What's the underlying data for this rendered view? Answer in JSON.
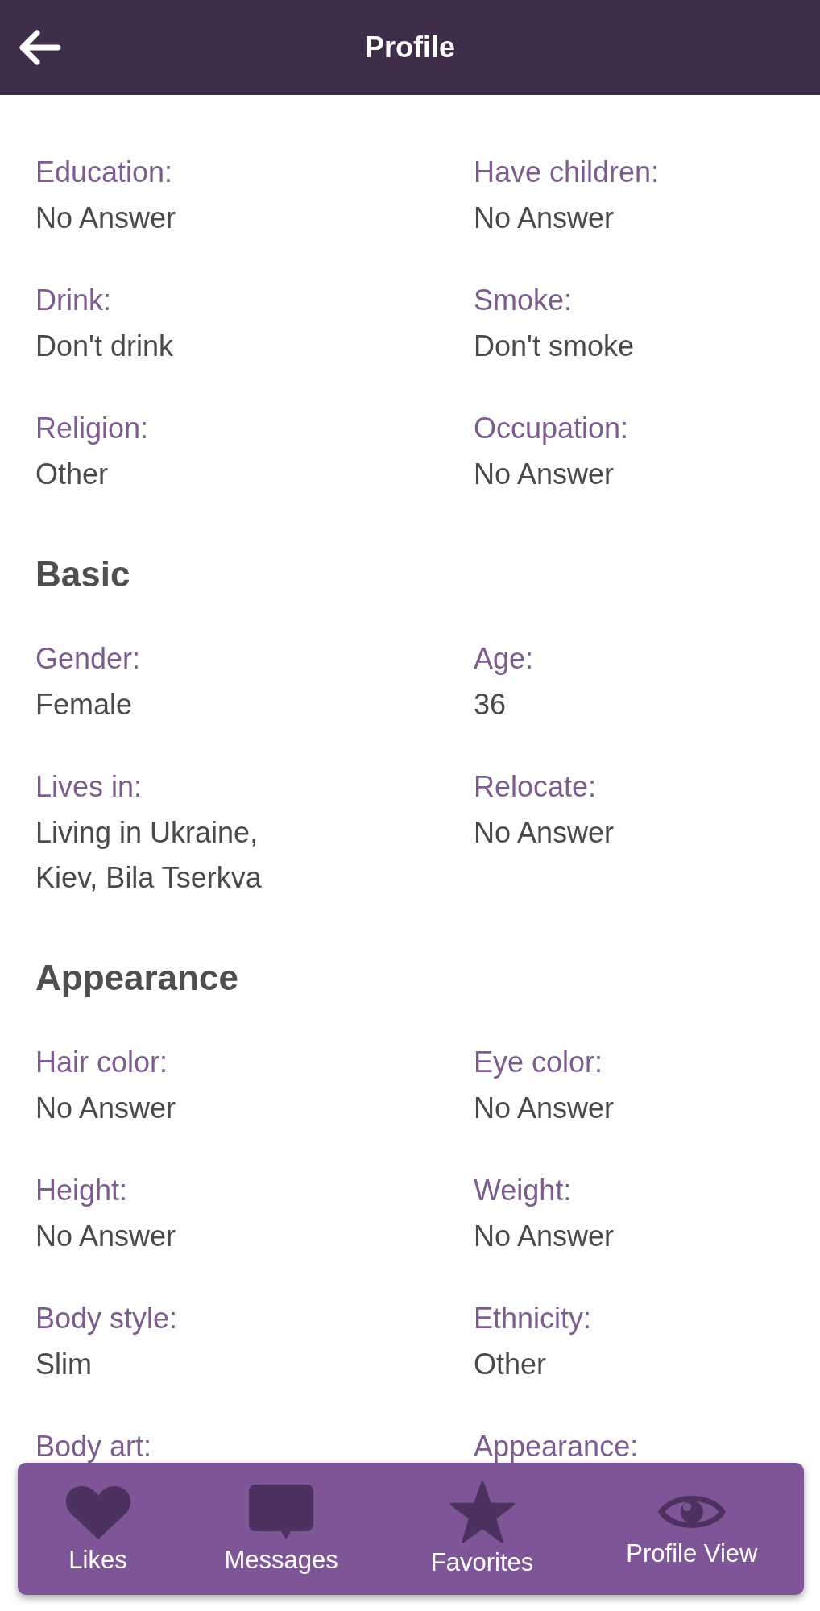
{
  "header": {
    "title": "Profile"
  },
  "sections": [
    {
      "fields": [
        {
          "label": "Education:",
          "value": "No Answer"
        },
        {
          "label": "Have children:",
          "value": "No Answer"
        },
        {
          "label": "Drink:",
          "value": "Don't drink"
        },
        {
          "label": "Smoke:",
          "value": "Don't smoke"
        },
        {
          "label": "Religion:",
          "value": "Other"
        },
        {
          "label": "Occupation:",
          "value": "No Answer"
        }
      ]
    },
    {
      "heading": "Basic",
      "fields": [
        {
          "label": "Gender:",
          "value": "Female"
        },
        {
          "label": "Age:",
          "value": "36"
        },
        {
          "label": "Lives in:",
          "value": "Living in Ukraine, Kiev, Bila Tserkva"
        },
        {
          "label": "Relocate:",
          "value": "No Answer"
        }
      ]
    },
    {
      "heading": "Appearance",
      "fields": [
        {
          "label": "Hair color:",
          "value": "No Answer"
        },
        {
          "label": "Eye color:",
          "value": "No Answer"
        },
        {
          "label": "Height:",
          "value": "No Answer"
        },
        {
          "label": "Weight:",
          "value": "No Answer"
        },
        {
          "label": "Body style:",
          "value": "Slim"
        },
        {
          "label": "Ethnicity:",
          "value": "Other"
        },
        {
          "label": "Body art:"
        },
        {
          "label": "Appearance:"
        }
      ]
    }
  ],
  "bottom_nav": [
    {
      "kind": "heart",
      "label": "Likes"
    },
    {
      "kind": "message",
      "label": "Messages"
    },
    {
      "kind": "star",
      "label": "Favorites"
    },
    {
      "kind": "eye",
      "label": "Profile View"
    }
  ]
}
